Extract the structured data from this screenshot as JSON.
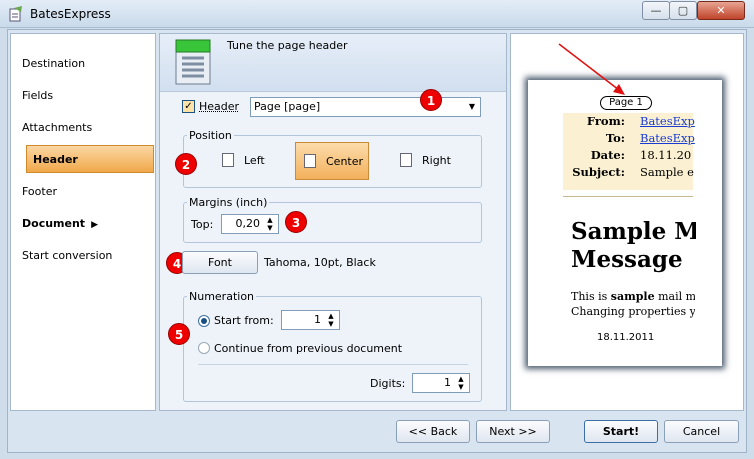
{
  "window": {
    "title": "BatesExpress",
    "icon": "bates-app-icon",
    "controls": {
      "minimize": "—",
      "maximize": "▢",
      "close": "✕"
    }
  },
  "sidebar": {
    "items": [
      {
        "label": "Destination"
      },
      {
        "label": "Fields"
      },
      {
        "label": "Attachments"
      },
      {
        "label": "Header",
        "active": true
      },
      {
        "label": "Footer"
      },
      {
        "label": "Document",
        "submenu": true
      },
      {
        "label": "Start conversion"
      }
    ]
  },
  "panel": {
    "title": "Tune the page header",
    "header_checkbox": {
      "label": "Header",
      "checked": true,
      "mark": "✓"
    },
    "header_value": "Page [page]",
    "position": {
      "legend": "Position",
      "options": [
        "Left",
        "Center",
        "Right"
      ],
      "selected": "Center"
    },
    "margins": {
      "legend": "Margins (inch)",
      "top_label": "Top:",
      "top_value": "0,20"
    },
    "font": {
      "button": "Font",
      "description": "Tahoma, 10pt, Black"
    },
    "numeration": {
      "legend": "Numeration",
      "start_from_label": "Start from:",
      "start_from_value": "1",
      "continue_label": "Continue from previous document",
      "digits_label": "Digits:",
      "digits_value": "1",
      "selected": "start_from"
    },
    "badges": [
      "1",
      "2",
      "3",
      "4",
      "5"
    ]
  },
  "preview": {
    "page_label": "Page 1",
    "fields": [
      {
        "key": "From:",
        "value": "BatesExp",
        "link": true
      },
      {
        "key": "To:",
        "value": "BatesExp",
        "link": true
      },
      {
        "key": "Date:",
        "value": "18.11.20",
        "link": false
      },
      {
        "key": "Subject:",
        "value": "Sample e",
        "link": false
      }
    ],
    "title_line1": "Sample M",
    "title_line2": "Message",
    "body_line1_pre": "This is ",
    "body_line1_bold": "sample",
    "body_line1_post": " mail me",
    "body_line2": "Changing properties yo",
    "footer_date": "18.11.2011"
  },
  "buttons": {
    "back": "<< Back",
    "next": "Next >>",
    "start": "Start!",
    "cancel": "Cancel"
  },
  "colors": {
    "accent_orange": "#f0a84a",
    "badge_red": "#e00000",
    "arrow_red": "#e01010",
    "link_blue": "#1a3cd0"
  }
}
